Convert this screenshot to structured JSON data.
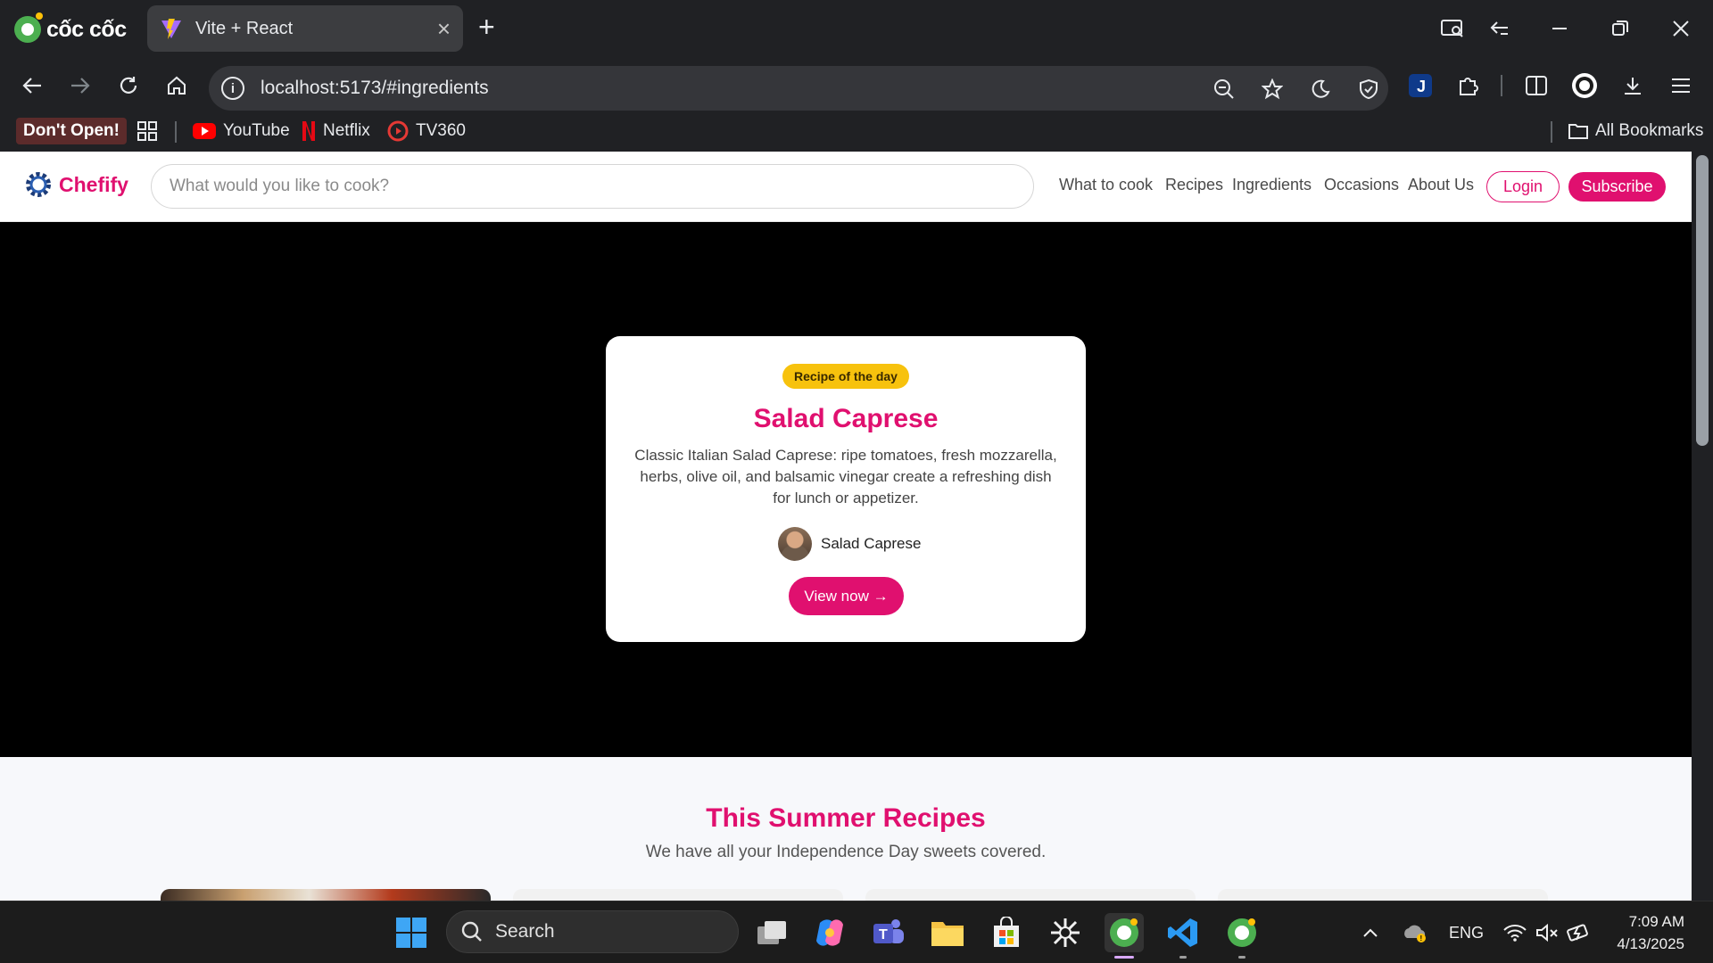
{
  "browser": {
    "brand_name": "cốc cốc",
    "tab_title": "Vite + React",
    "url": "localhost:5173/#ingredients",
    "bookmarks": [
      {
        "label": "Don't Open!"
      },
      {
        "label": "YouTube",
        "icon": "youtube-icon"
      },
      {
        "label": "Netflix",
        "icon": "netflix-icon"
      },
      {
        "label": "TV360",
        "icon": "tv360-icon"
      }
    ],
    "all_bookmarks_label": "All Bookmarks"
  },
  "site": {
    "brand": "Chefify",
    "search_placeholder": "What would you like to cook?",
    "nav": [
      "What to cook",
      "Recipes",
      "Ingredients",
      "Occasions",
      "About Us"
    ],
    "login_label": "Login",
    "subscribe_label": "Subscribe",
    "accent_color": "#e0106f"
  },
  "hero_card": {
    "badge": "Recipe of the day",
    "title": "Salad Caprese",
    "description": "Classic Italian Salad Caprese: ripe tomatoes, fresh mozzarella, herbs, olive oil, and balsamic vinegar create a refreshing dish for lunch or appetizer.",
    "author": "Salad Caprese",
    "cta": "View now →"
  },
  "summer_section": {
    "title": "This Summer Recipes",
    "subtitle": "We have all your Independence Day sweets covered."
  },
  "taskbar": {
    "search_label": "Search",
    "language": "ENG",
    "time": "7:09 AM",
    "date": "4/13/2025"
  }
}
